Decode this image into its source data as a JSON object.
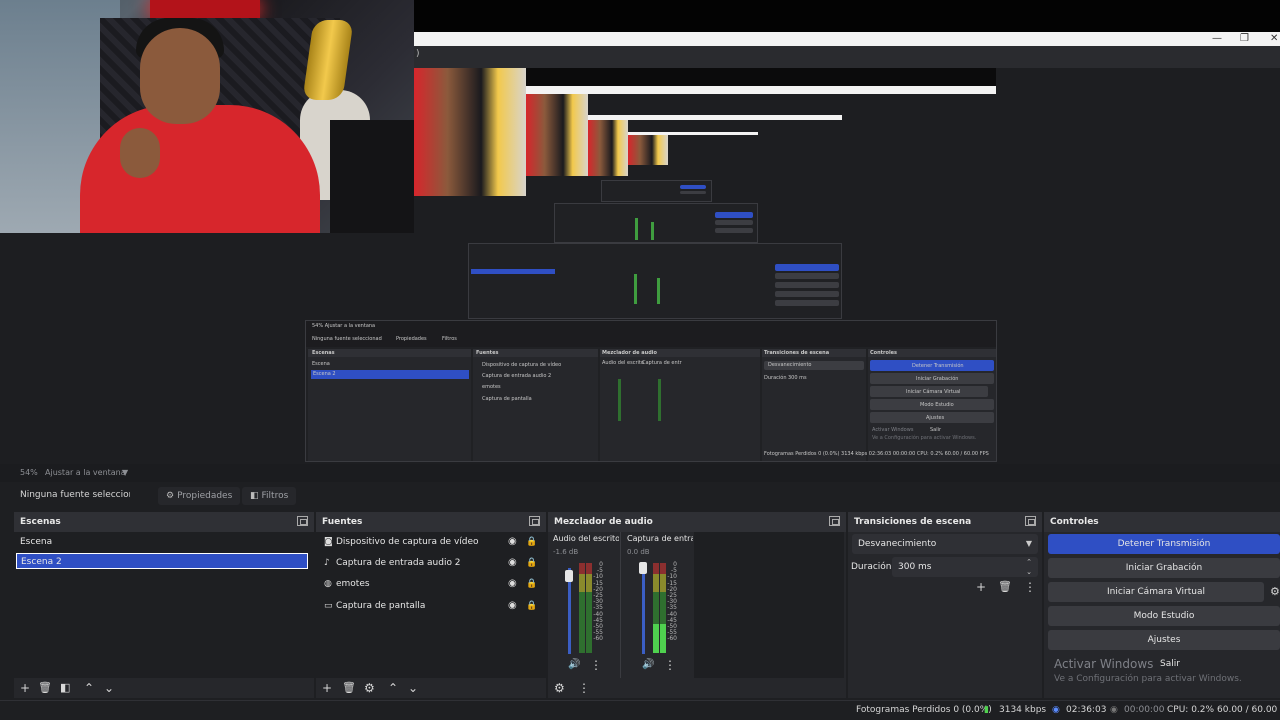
{
  "preview": {
    "window_controls": {
      "minimize": "—",
      "restore": "❐",
      "close": "✕"
    },
    "mini_texts": {
      "n1_row_left": "54%   Ajustar a la ventana",
      "n1_ctx": "Ninguna fuente seleccionad",
      "n1_props": "Propiedades",
      "n1_filters": "Filtros",
      "escenas": "Escenas",
      "fuentes": "Fuentes",
      "mezclador": "Mezclador de audio",
      "transiciones": "Transiciones de escena",
      "controles": "Controles",
      "escena": "Escena",
      "escena2": "Escena 2",
      "src1": "Dispositivo de captura de vídeo",
      "src2": "Captura de entrada audio 2",
      "src3": "emotes",
      "src4": "Captura de pantalla",
      "audio1": "Audio del escrito",
      "audio2": "Captura de entr",
      "desv": "Desvanecimiento",
      "duracion": "Duración",
      "ms": "300 ms",
      "detener": "Detener Transmisión",
      "grabacion": "Iniciar Grabación",
      "camara": "Iniciar Cámara Virtual",
      "estudio": "Modo Estudio",
      "ajustes": "Ajustes",
      "activar": "Activar Windows",
      "salir": "Salir",
      "activar_sub": "Ve a Configuración para activar Windows.",
      "status": "Fotogramas Perdidos 0 (0.0%)   3134 kbps   02:36:03   00:00:00   CPU: 0.2%   60.00 / 60.00 FPS"
    }
  },
  "scalebar": {
    "zoom": "54%",
    "fit": "Ajustar a la ventana",
    "arrow": "▼"
  },
  "context": {
    "no_source": "Ninguna fuente seleccionad",
    "properties": "Propiedades",
    "filters": "Filtros"
  },
  "docks": {
    "scenes": {
      "title": "Escenas",
      "items": [
        "Escena",
        "Escena 2"
      ],
      "selected_index": 1
    },
    "sources": {
      "title": "Fuentes",
      "items": [
        {
          "label": "Dispositivo de captura de vídeo",
          "icon": "camera-icon"
        },
        {
          "label": "Captura de entrada audio 2",
          "icon": "microphone-icon"
        },
        {
          "label": "emotes",
          "icon": "browser-icon"
        },
        {
          "label": "Captura de pantalla",
          "icon": "monitor-icon"
        }
      ]
    },
    "mixer": {
      "title": "Mezclador de audio",
      "channels": [
        {
          "name": "Audio del escrito",
          "db": "-1.6 dB"
        },
        {
          "name": "Captura de entra",
          "db": "0.0 dB"
        }
      ],
      "ticks": [
        "0",
        "-5",
        "-10",
        "-15",
        "-20",
        "-25",
        "-30",
        "-35",
        "-40",
        "-45",
        "-50",
        "-55",
        "-60"
      ]
    },
    "transitions": {
      "title": "Transiciones de escena",
      "type": "Desvanecimiento",
      "duration_label": "Duración",
      "duration_value": "300 ms"
    },
    "controls": {
      "title": "Controles",
      "stop_stream": "Detener Transmisión",
      "start_recording": "Iniciar Grabación",
      "start_virtual_cam": "Iniciar Cámara Virtual",
      "studio_mode": "Modo Estudio",
      "settings": "Ajustes"
    }
  },
  "watermark": {
    "title": "Activar Windows",
    "exit": "Salir",
    "subtitle": "Ve a Configuración para activar Windows."
  },
  "status": {
    "dropped": "Fotogramas Perdidos 0 (0.0%)",
    "bitrate": "3134 kbps",
    "stream_time": "02:36:03",
    "rec_time": "00:00:00",
    "cpu": "CPU: 0.2%",
    "fps": "60.00 / 60.00 FPS"
  },
  "colors": {
    "accent": "#2f4fc4",
    "dock_bg": "#1e1f22",
    "meter_green": "#4fd14f"
  }
}
